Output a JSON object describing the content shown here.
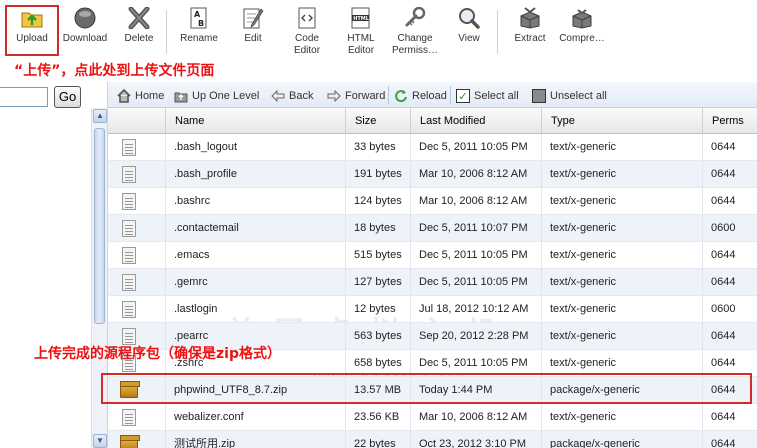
{
  "toolbar": {
    "buttons": [
      {
        "label": "Upload",
        "icon": "upload-icon"
      },
      {
        "label": "Download",
        "icon": "download-icon"
      },
      {
        "label": "Delete",
        "icon": "delete-icon"
      },
      {
        "label": "Rename",
        "icon": "rename-icon"
      },
      {
        "label": "Edit",
        "icon": "edit-icon"
      },
      {
        "label": "Code",
        "label2": "Editor",
        "icon": "code-editor-icon"
      },
      {
        "label": "HTML",
        "label2": "Editor",
        "icon": "html-editor-icon"
      },
      {
        "label": "Change",
        "label2": "Permiss…",
        "icon": "change-permissions-icon"
      },
      {
        "label": "View",
        "icon": "view-icon"
      },
      {
        "label": "Extract",
        "icon": "extract-icon"
      },
      {
        "label": "Compre…",
        "icon": "compress-icon"
      }
    ]
  },
  "annotations": {
    "upload_note": "“上传”，点此处到上传文件页面",
    "zip_note": "上传完成的源程序包（确保是zip格式）",
    "color": "#e11111"
  },
  "watermark": {
    "text": "美国虚拟主机",
    "url": "www.host114.org"
  },
  "left_panel": {
    "search_value": "",
    "go_label": "Go"
  },
  "navbar": {
    "home": "Home",
    "up_one_level": "Up One Level",
    "back": "Back",
    "forward": "Forward",
    "reload": "Reload",
    "select_all": "Select all",
    "unselect_all": "Unselect all"
  },
  "table": {
    "headers": {
      "name": "Name",
      "size": "Size",
      "modified": "Last Modified",
      "type": "Type",
      "perms": "Perms"
    },
    "rows": [
      {
        "name": ".bash_logout",
        "size": "33 bytes",
        "modified": "Dec 5, 2011 10:05 PM",
        "type": "text/x-generic",
        "perms": "0644",
        "icon": "document-icon"
      },
      {
        "name": ".bash_profile",
        "size": "191 bytes",
        "modified": "Mar 10, 2006 8:12 AM",
        "type": "text/x-generic",
        "perms": "0644",
        "icon": "document-icon"
      },
      {
        "name": ".bashrc",
        "size": "124 bytes",
        "modified": "Mar 10, 2006 8:12 AM",
        "type": "text/x-generic",
        "perms": "0644",
        "icon": "document-icon"
      },
      {
        "name": ".contactemail",
        "size": "18 bytes",
        "modified": "Dec 5, 2011 10:07 PM",
        "type": "text/x-generic",
        "perms": "0600",
        "icon": "document-icon"
      },
      {
        "name": ".emacs",
        "size": "515 bytes",
        "modified": "Dec 5, 2011 10:05 PM",
        "type": "text/x-generic",
        "perms": "0644",
        "icon": "document-icon"
      },
      {
        "name": ".gemrc",
        "size": "127 bytes",
        "modified": "Dec 5, 2011 10:05 PM",
        "type": "text/x-generic",
        "perms": "0644",
        "icon": "document-icon"
      },
      {
        "name": ".lastlogin",
        "size": "12 bytes",
        "modified": "Jul 18, 2012 10:12 AM",
        "type": "text/x-generic",
        "perms": "0600",
        "icon": "document-icon"
      },
      {
        "name": ".pearrc",
        "size": "563 bytes",
        "modified": "Sep 20, 2012 2:28 PM",
        "type": "text/x-generic",
        "perms": "0644",
        "icon": "document-icon"
      },
      {
        "name": ".zshrc",
        "size": "658 bytes",
        "modified": "Dec 5, 2011 10:05 PM",
        "type": "text/x-generic",
        "perms": "0644",
        "icon": "document-icon"
      },
      {
        "name": "phpwind_UTF8_8.7.zip",
        "size": "13.57 MB",
        "modified": "Today 1:44 PM",
        "type": "package/x-generic",
        "perms": "0644",
        "icon": "package-icon"
      },
      {
        "name": "webalizer.conf",
        "size": "23.56 KB",
        "modified": "Mar 10, 2006 8:12 AM",
        "type": "text/x-generic",
        "perms": "0644",
        "icon": "document-icon"
      },
      {
        "name": "测试所用.zip",
        "size": "22 bytes",
        "modified": "Oct 23, 2012 3:10 PM",
        "type": "package/x-generic",
        "perms": "0644",
        "icon": "package-icon"
      }
    ]
  }
}
